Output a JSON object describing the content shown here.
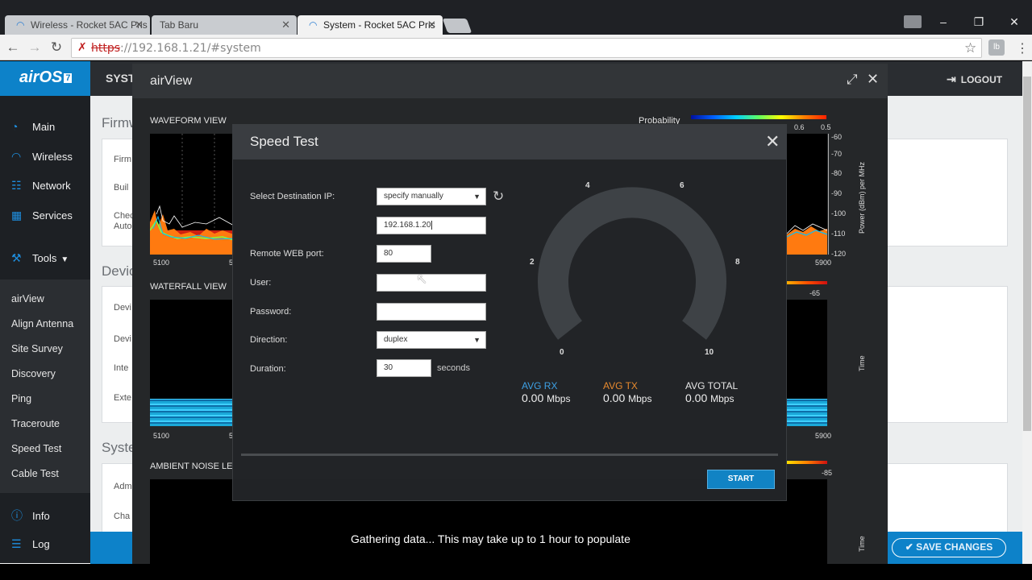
{
  "browser": {
    "tabs": [
      {
        "label": "Wireless - Rocket 5AC Pris",
        "active": false
      },
      {
        "label": "Tab Baru",
        "active": false
      },
      {
        "label": "System - Rocket 5AC Pris",
        "active": true
      }
    ],
    "url_scheme": "https",
    "url_rest": "://192.168.1.21/#system",
    "extension_label": "lb"
  },
  "app": {
    "logo_text": "airOS",
    "logo_version": "7",
    "header_section": "SYST",
    "logout_label": "LOGOUT",
    "nav": {
      "main": "Main",
      "wireless": "Wireless",
      "network": "Network",
      "services": "Services",
      "tools": "Tools",
      "info": "Info",
      "log": "Log"
    },
    "tools_items": [
      "airView",
      "Align Antenna",
      "Site Survey",
      "Discovery",
      "Ping",
      "Traceroute",
      "Speed Test",
      "Cable Test"
    ],
    "sections": {
      "firmware": "Firmw",
      "device": "Devic",
      "system": "Syste"
    },
    "firmware_rows": [
      "Firm",
      "Buil",
      "Chec",
      "Auto"
    ],
    "device_rows": [
      "Devi",
      "Devi",
      "Inte",
      "Exte"
    ],
    "system_rows": [
      "Adm",
      "Cha"
    ],
    "save_changes_label": "SAVE CHANGES"
  },
  "airview": {
    "title": "airView",
    "waveform_label": "WAVEFORM VIEW",
    "waterfall_label": "WATERFALL VIEW",
    "ambient_label": "AMBIENT NOISE LE",
    "probability_label": "Probability",
    "prob_ticks": [
      "0.6",
      "0.5"
    ],
    "power_axis_label": "Power (dBm) per MHz",
    "power_ticks": [
      "-60",
      "-70",
      "-80",
      "-90",
      "-100",
      "-110",
      "-120"
    ],
    "freq_start": "5100",
    "freq_start_clip": "5",
    "freq_end": "5900",
    "time_label": "Time",
    "waterfall_max": "-65",
    "ambient_max": "-85",
    "gathering_text": "Gathering data... This may take up to 1 hour to populate"
  },
  "speedtest": {
    "title": "Speed Test",
    "dest_label": "Select Destination IP:",
    "dest_value": "specify manually",
    "ip_value": "192.168.1.20",
    "port_label": "Remote WEB port:",
    "port_value": "80",
    "user_label": "User:",
    "user_value": "",
    "password_label": "Password:",
    "password_value": "",
    "direction_label": "Direction:",
    "direction_value": "duplex",
    "duration_label": "Duration:",
    "duration_value": "30",
    "duration_unit": "seconds",
    "gauge_labels": [
      "0",
      "2",
      "4",
      "6",
      "8",
      "10"
    ],
    "avg_rx_label": "AVG RX",
    "avg_rx_value": "0.00",
    "avg_tx_label": "AVG TX",
    "avg_tx_value": "0.00",
    "avg_total_label": "AVG TOTAL",
    "avg_total_value": "0.00",
    "unit": "Mbps",
    "start_label": "START",
    "colors": {
      "rx": "#3ea0e4",
      "tx": "#e88a2e",
      "accent": "#1183c4"
    }
  }
}
